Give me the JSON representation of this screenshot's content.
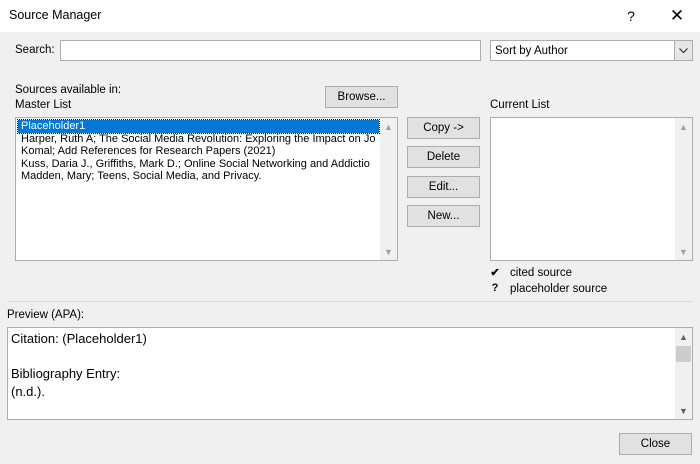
{
  "window": {
    "title": "Source Manager",
    "help_glyph": "?",
    "close_glyph": "✕"
  },
  "search": {
    "label": "Search:",
    "value": "",
    "placeholder": ""
  },
  "sort": {
    "selected": "Sort by Author"
  },
  "master": {
    "sources_label": "Sources available in:",
    "list_label": "Master List",
    "browse_label": "Browse...",
    "items": [
      {
        "label": "Placeholder1",
        "selected": true
      },
      {
        "label": "Harper, Ruth A; The Social Media Revolution: Exploring the Impact on Jo",
        "selected": false
      },
      {
        "label": "Komal; Add References for Research Papers (2021)",
        "selected": false
      },
      {
        "label": "Kuss, Daria J., Griffiths, Mark D.; Online Social Networking and Addictio",
        "selected": false
      },
      {
        "label": "Madden, Mary; Teens, Social Media, and Privacy.",
        "selected": false
      }
    ]
  },
  "actions": {
    "copy": "Copy ->",
    "delete": "Delete",
    "edit": "Edit...",
    "new": "New..."
  },
  "current": {
    "label": "Current List",
    "items": []
  },
  "legend": {
    "cited_symbol": "✔",
    "cited_label": "cited source",
    "placeholder_symbol": "?",
    "placeholder_label": "placeholder source"
  },
  "preview": {
    "label": "Preview (APA):",
    "citation": "Citation:  (Placeholder1)",
    "bibliography_label": "Bibliography Entry:",
    "bibliography_value": "(n.d.)."
  },
  "footer": {
    "close_label": "Close"
  },
  "colors": {
    "selection": "#0078d7",
    "dialog_bg": "#f0f0f0"
  }
}
